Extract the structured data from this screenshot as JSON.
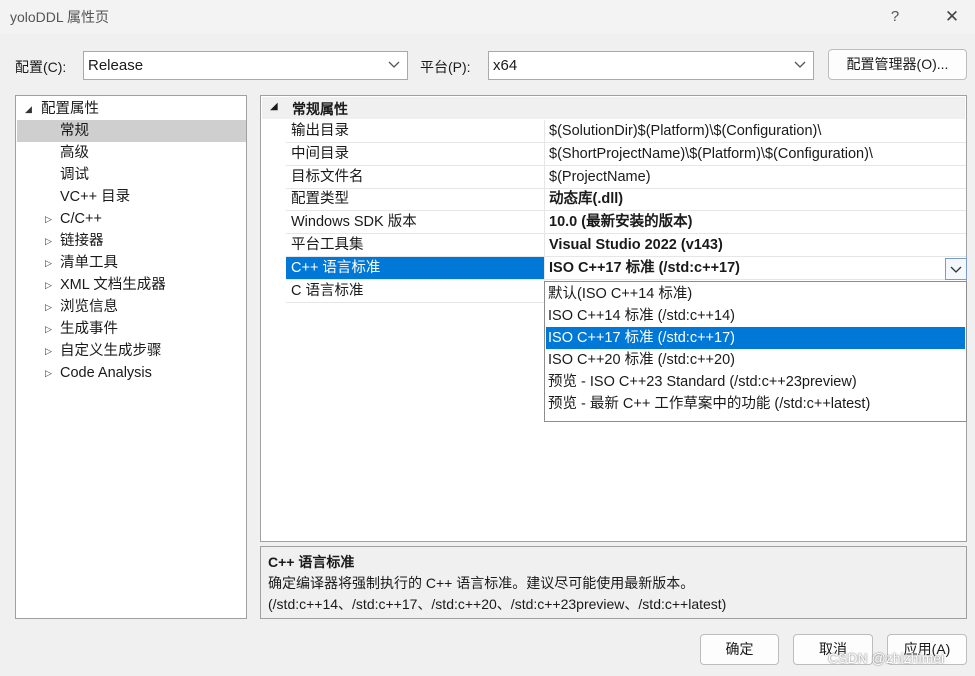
{
  "window": {
    "title": "yoloDDL 属性页",
    "help": "?",
    "close": "✕"
  },
  "config": {
    "label": "配置(C):",
    "value": "Release"
  },
  "platform": {
    "label": "平台(P):",
    "value": "x64"
  },
  "config_manager_button": "配置管理器(O)...",
  "tree": {
    "root": "配置属性",
    "items": [
      {
        "label": "常规",
        "selected": true,
        "expandable": false
      },
      {
        "label": "高级",
        "expandable": false
      },
      {
        "label": "调试",
        "expandable": false
      },
      {
        "label": "VC++ 目录",
        "expandable": false
      },
      {
        "label": "C/C++",
        "expandable": true
      },
      {
        "label": "链接器",
        "expandable": true
      },
      {
        "label": "清单工具",
        "expandable": true
      },
      {
        "label": "XML 文档生成器",
        "expandable": true
      },
      {
        "label": "浏览信息",
        "expandable": true
      },
      {
        "label": "生成事件",
        "expandable": true
      },
      {
        "label": "自定义生成步骤",
        "expandable": true
      },
      {
        "label": "Code Analysis",
        "expandable": true
      }
    ]
  },
  "grid": {
    "section": "常规属性",
    "rows": [
      {
        "name": "输出目录",
        "value": "$(SolutionDir)$(Platform)\\$(Configuration)\\"
      },
      {
        "name": "中间目录",
        "value": "$(ShortProjectName)\\$(Platform)\\$(Configuration)\\"
      },
      {
        "name": "目标文件名",
        "value": "$(ProjectName)"
      },
      {
        "name": "配置类型",
        "value": "动态库(.dll)"
      },
      {
        "name": "Windows SDK 版本",
        "value": "10.0 (最新安装的版本)"
      },
      {
        "name": "平台工具集",
        "value": "Visual Studio 2022 (v143)"
      },
      {
        "name": "C++ 语言标准",
        "value": "ISO C++17 标准 (/std:c++17)"
      },
      {
        "name": "C 语言标准",
        "value": ""
      }
    ]
  },
  "dropdown": {
    "options": [
      "默认(ISO C++14 标准)",
      "ISO C++14 标准 (/std:c++14)",
      "ISO C++17 标准 (/std:c++17)",
      "ISO C++20 标准 (/std:c++20)",
      "预览 - ISO C++23 Standard (/std:c++23preview)",
      "预览 - 最新 C++ 工作草案中的功能 (/std:c++latest)"
    ],
    "selected_index": 2
  },
  "description": {
    "title": "C++ 语言标准",
    "text": "确定编译器将强制执行的 C++ 语言标准。建议尽可能使用最新版本。(/std:c++14、/std:c++17、/std:c++20、/std:c++23preview、/std:c++latest)"
  },
  "buttons": {
    "ok": "确定",
    "cancel": "取消",
    "apply": "应用(A)"
  },
  "watermark": "CSDN @zhizhimei",
  "colors": {
    "selection": "#0078d7",
    "tree_selection": "#cfcfcf"
  }
}
